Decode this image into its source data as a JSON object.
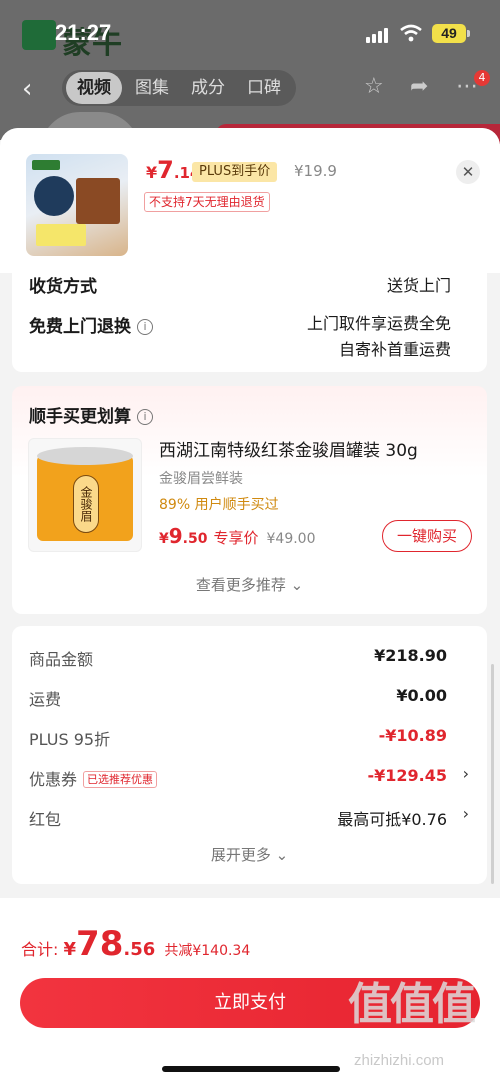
{
  "status_bar": {
    "time": "21:27",
    "battery": "49"
  },
  "brand_logo": {
    "text": "蒙牛"
  },
  "top_nav": {
    "tabs": [
      "视频",
      "图集",
      "成分",
      "口碑"
    ],
    "active_tab": "视频",
    "message_count": "4"
  },
  "sheet_header": {
    "price_yen": "¥",
    "price_int": "7",
    "price_dec": ".14",
    "plus_tag": "PLUS到手价",
    "original_price": "¥19.9",
    "return_notice": "不支持7天无理由退货"
  },
  "delivery": {
    "method_label": "收货方式",
    "method_value": "送货上门",
    "return_label": "免费上门退换",
    "return_line1": "上门取件享运费全免",
    "return_line2": "自寄补首重运费"
  },
  "recommend": {
    "title": "顺手买更划算",
    "product_name": "西湖江南特级红茶金骏眉罐装 30g",
    "can_label": "金骏眉",
    "sub": "金骏眉尝鲜装",
    "bought": "89% 用户顺手买过",
    "price_yen": "¥",
    "price_int": "9",
    "price_dec": ".50",
    "price_tag": "专享价",
    "orig_price": "¥49.00",
    "buy_label": "一键购买",
    "more_label": "查看更多推荐"
  },
  "summary": {
    "rows": [
      {
        "label": "商品金额",
        "value": "¥218.90"
      },
      {
        "label": "运费",
        "value": "¥0.00"
      },
      {
        "label": "PLUS 95折",
        "value": "-¥10.89"
      },
      {
        "label": "优惠券",
        "value": "-¥129.45",
        "tag": "已选推荐优惠"
      },
      {
        "label": "红包",
        "value": "最高可抵¥0.76"
      }
    ],
    "expand_label": "展开更多"
  },
  "footer": {
    "total_label": "合计:",
    "total_yen": "¥",
    "total_int": "78",
    "total_dec": ".56",
    "saved": "共减¥140.34",
    "pay_label": "立即支付"
  },
  "watermark": {
    "chars": "值值值",
    "url": "zhizhizhi.com"
  },
  "colors": {
    "accent_red": "#e0262e",
    "plus_gold": "#fbe6a6"
  }
}
